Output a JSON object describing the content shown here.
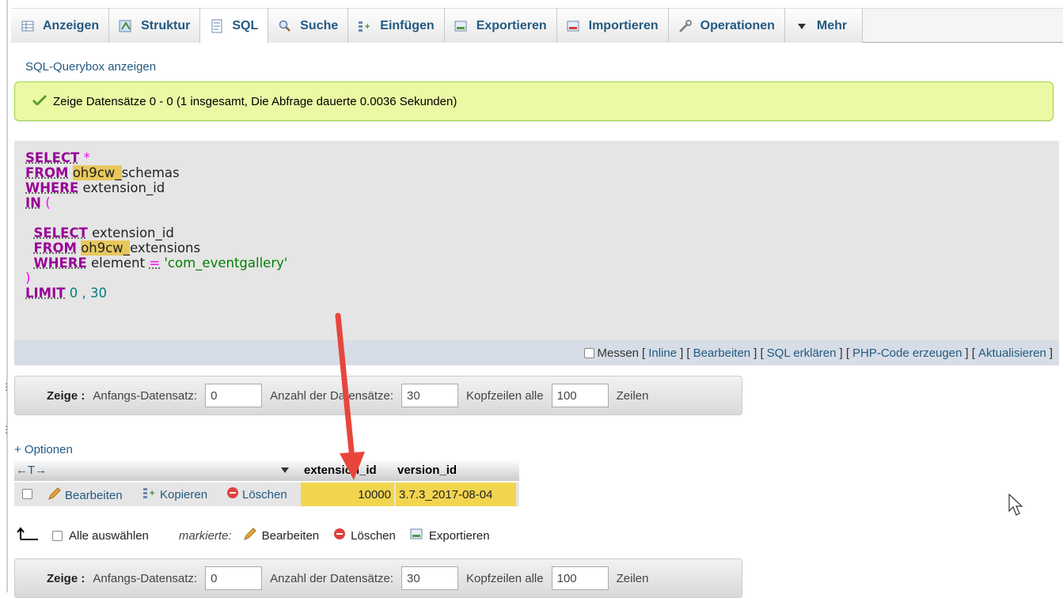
{
  "tabs": [
    {
      "label": "Anzeigen",
      "icon": "table-icon"
    },
    {
      "label": "Struktur",
      "icon": "structure-icon"
    },
    {
      "label": "SQL",
      "icon": "sql-icon"
    },
    {
      "label": "Suche",
      "icon": "search-icon"
    },
    {
      "label": "Einfügen",
      "icon": "insert-icon"
    },
    {
      "label": "Exportieren",
      "icon": "export-icon"
    },
    {
      "label": "Importieren",
      "icon": "import-icon"
    },
    {
      "label": "Operationen",
      "icon": "wrench-icon"
    },
    {
      "label": "Mehr",
      "icon": "triangle-down-icon"
    }
  ],
  "active_tab": "SQL",
  "querybox_link": "SQL-Querybox anzeigen",
  "success_message": "Zeige Datensätze 0 - 0 (1 insgesamt, Die Abfrage dauerte 0.0036 Sekunden)",
  "sql": {
    "select": "SELECT",
    "star": "*",
    "from": "FROM",
    "prefix": "oh9cw_",
    "table1": "schemas",
    "where": "WHERE",
    "col": "extension_id",
    "in": "IN",
    "lparen": "(",
    "rparen": ")",
    "table2": "extensions",
    "element": "element",
    "eq": "=",
    "value": "'com_eventgallery'",
    "limit": "LIMIT",
    "limit_vals": "0 , 30"
  },
  "sql_actions": {
    "messen": "Messen",
    "inline": "Inline",
    "bearbeiten": "Bearbeiten",
    "erklaeren": "SQL erklären",
    "php": "PHP-Code erzeugen",
    "aktualisieren": "Aktualisieren"
  },
  "nav": {
    "zeige": "Zeige :",
    "start_label": "Anfangs-Datensatz:",
    "start_value": "0",
    "count_label": "Anzahl der Datensätze:",
    "count_value": "30",
    "header_label": "Kopfzeilen alle",
    "header_value": "100",
    "rows_label": "Zeilen"
  },
  "options_link": "+ Optionen",
  "table": {
    "columns": [
      "extension_id",
      "version_id"
    ],
    "rows": [
      {
        "extension_id": "10000",
        "version_id": "3.7.3_2017-08-04"
      }
    ],
    "row_actions": {
      "edit": "Bearbeiten",
      "copy": "Kopieren",
      "delete": "Löschen"
    }
  },
  "bulk": {
    "select_all": "Alle auswählen",
    "marked": "markierte:",
    "edit": "Bearbeiten",
    "delete": "Löschen",
    "export": "Exportieren"
  },
  "colors": {
    "link": "#235a81",
    "success_bg": "#ebf8a4",
    "highlight": "#f1d54f",
    "arrow": "#e8463c"
  }
}
